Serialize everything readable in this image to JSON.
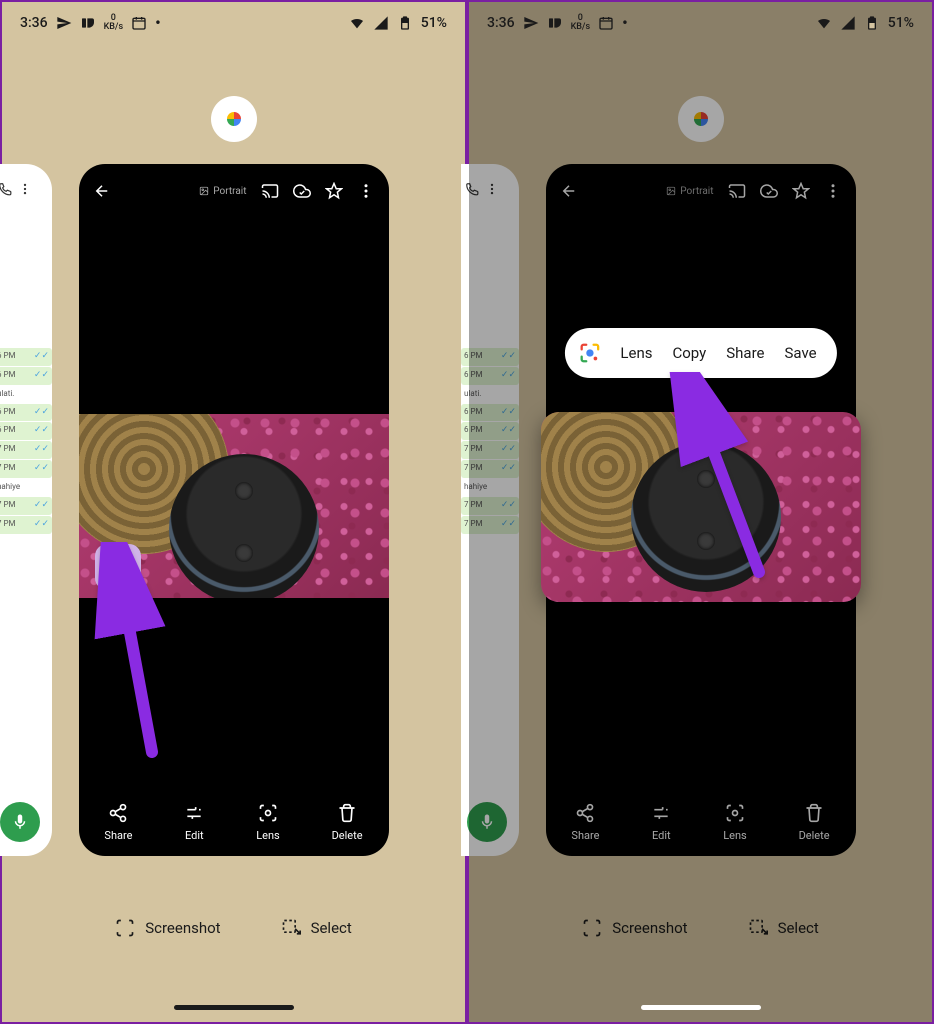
{
  "status": {
    "time": "3:36",
    "kbs_top": "0",
    "kbs_bottom": "KB/s",
    "battery": "51%",
    "icons": {
      "send": "send-icon",
      "badge": "badge-icon",
      "speed": "speed-icon",
      "calendar": "calendar-icon",
      "dot": "•",
      "wifi": "wifi-icon",
      "signal": "signal-icon",
      "batt": "battery-icon"
    }
  },
  "app_icon": "google-photos-icon",
  "photo_viewer": {
    "back": "back-icon",
    "mode_label": "Portrait",
    "top_icons": {
      "cast": "cast-icon",
      "cloud": "cloud-check-icon",
      "star": "star-icon",
      "more": "more-vert-icon"
    },
    "image_chip": "image-icon",
    "bottom": {
      "share": "Share",
      "edit": "Edit",
      "lens": "Lens",
      "delete": "Delete"
    }
  },
  "side_app": {
    "phone": "phone-icon",
    "more": "more-vert-icon",
    "rows": [
      {
        "t": "6 PM",
        "tick": true
      },
      {
        "t": "6 PM",
        "tick": true
      },
      {
        "t": "ulati.",
        "tick": false
      },
      {
        "t": "6 PM",
        "tick": true
      },
      {
        "t": "6 PM",
        "tick": true
      },
      {
        "t": "7 PM",
        "tick": true
      },
      {
        "t": "7 PM",
        "tick": true
      },
      {
        "t": "hahiye",
        "tick": false
      },
      {
        "t": "7 PM",
        "tick": true
      },
      {
        "t": "7 PM",
        "tick": true
      }
    ],
    "mic": "mic-icon"
  },
  "recents_footer": {
    "screenshot": "Screenshot",
    "select": "Select"
  },
  "popup": {
    "lens_icon": "google-lens-icon",
    "lens": "Lens",
    "copy": "Copy",
    "share": "Share",
    "save": "Save"
  }
}
